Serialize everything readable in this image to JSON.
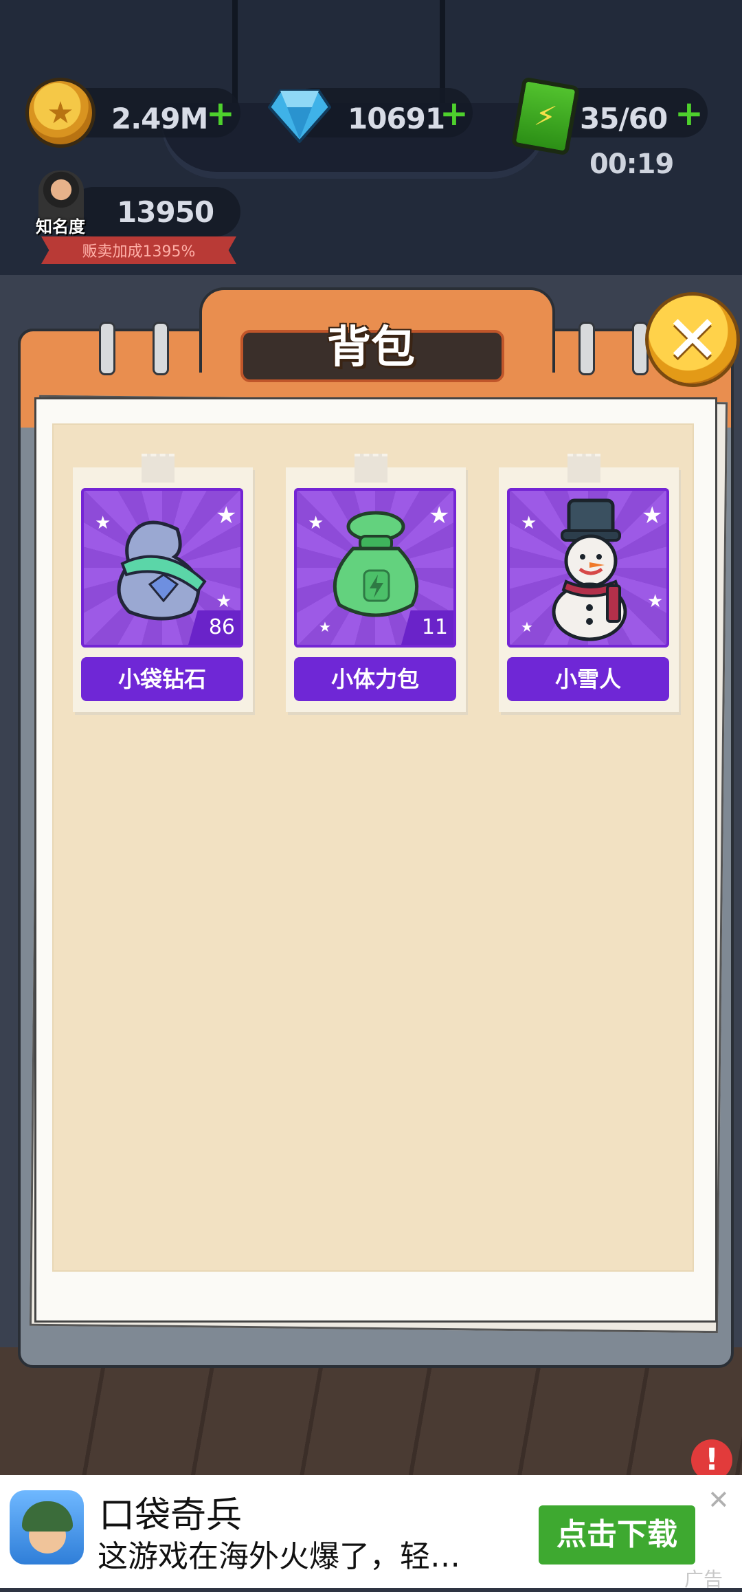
{
  "hud": {
    "coins": "2.49M",
    "gems": "10691",
    "energy": "35/60",
    "energy_timer": "00:19",
    "fame_label": "知名度",
    "fame_value": "13950",
    "sell_bonus": "贩卖加成1395%",
    "plus_glyph": "+"
  },
  "panel": {
    "title": "背包",
    "close_glyph": "✕"
  },
  "items": [
    {
      "name": "小袋钻石",
      "count": "86",
      "icon": "diamond-bag-icon",
      "color": "#9aa8d2"
    },
    {
      "name": "小体力包",
      "count": "11",
      "icon": "stamina-bag-icon",
      "color": "#63d27e"
    },
    {
      "name": "小雪人",
      "count": "",
      "icon": "snowman-icon",
      "color": "#f3f0ec"
    }
  ],
  "ad": {
    "title": "口袋奇兵",
    "description": "这游戏在海外火爆了，轻…",
    "button": "点击下载",
    "close_glyph": "✕",
    "tag": "广告"
  },
  "colors": {
    "panel_orange": "#e98e4f",
    "item_purple": "#6f27d6",
    "plus_green": "#4ed12d",
    "download_green": "#3ea930"
  }
}
